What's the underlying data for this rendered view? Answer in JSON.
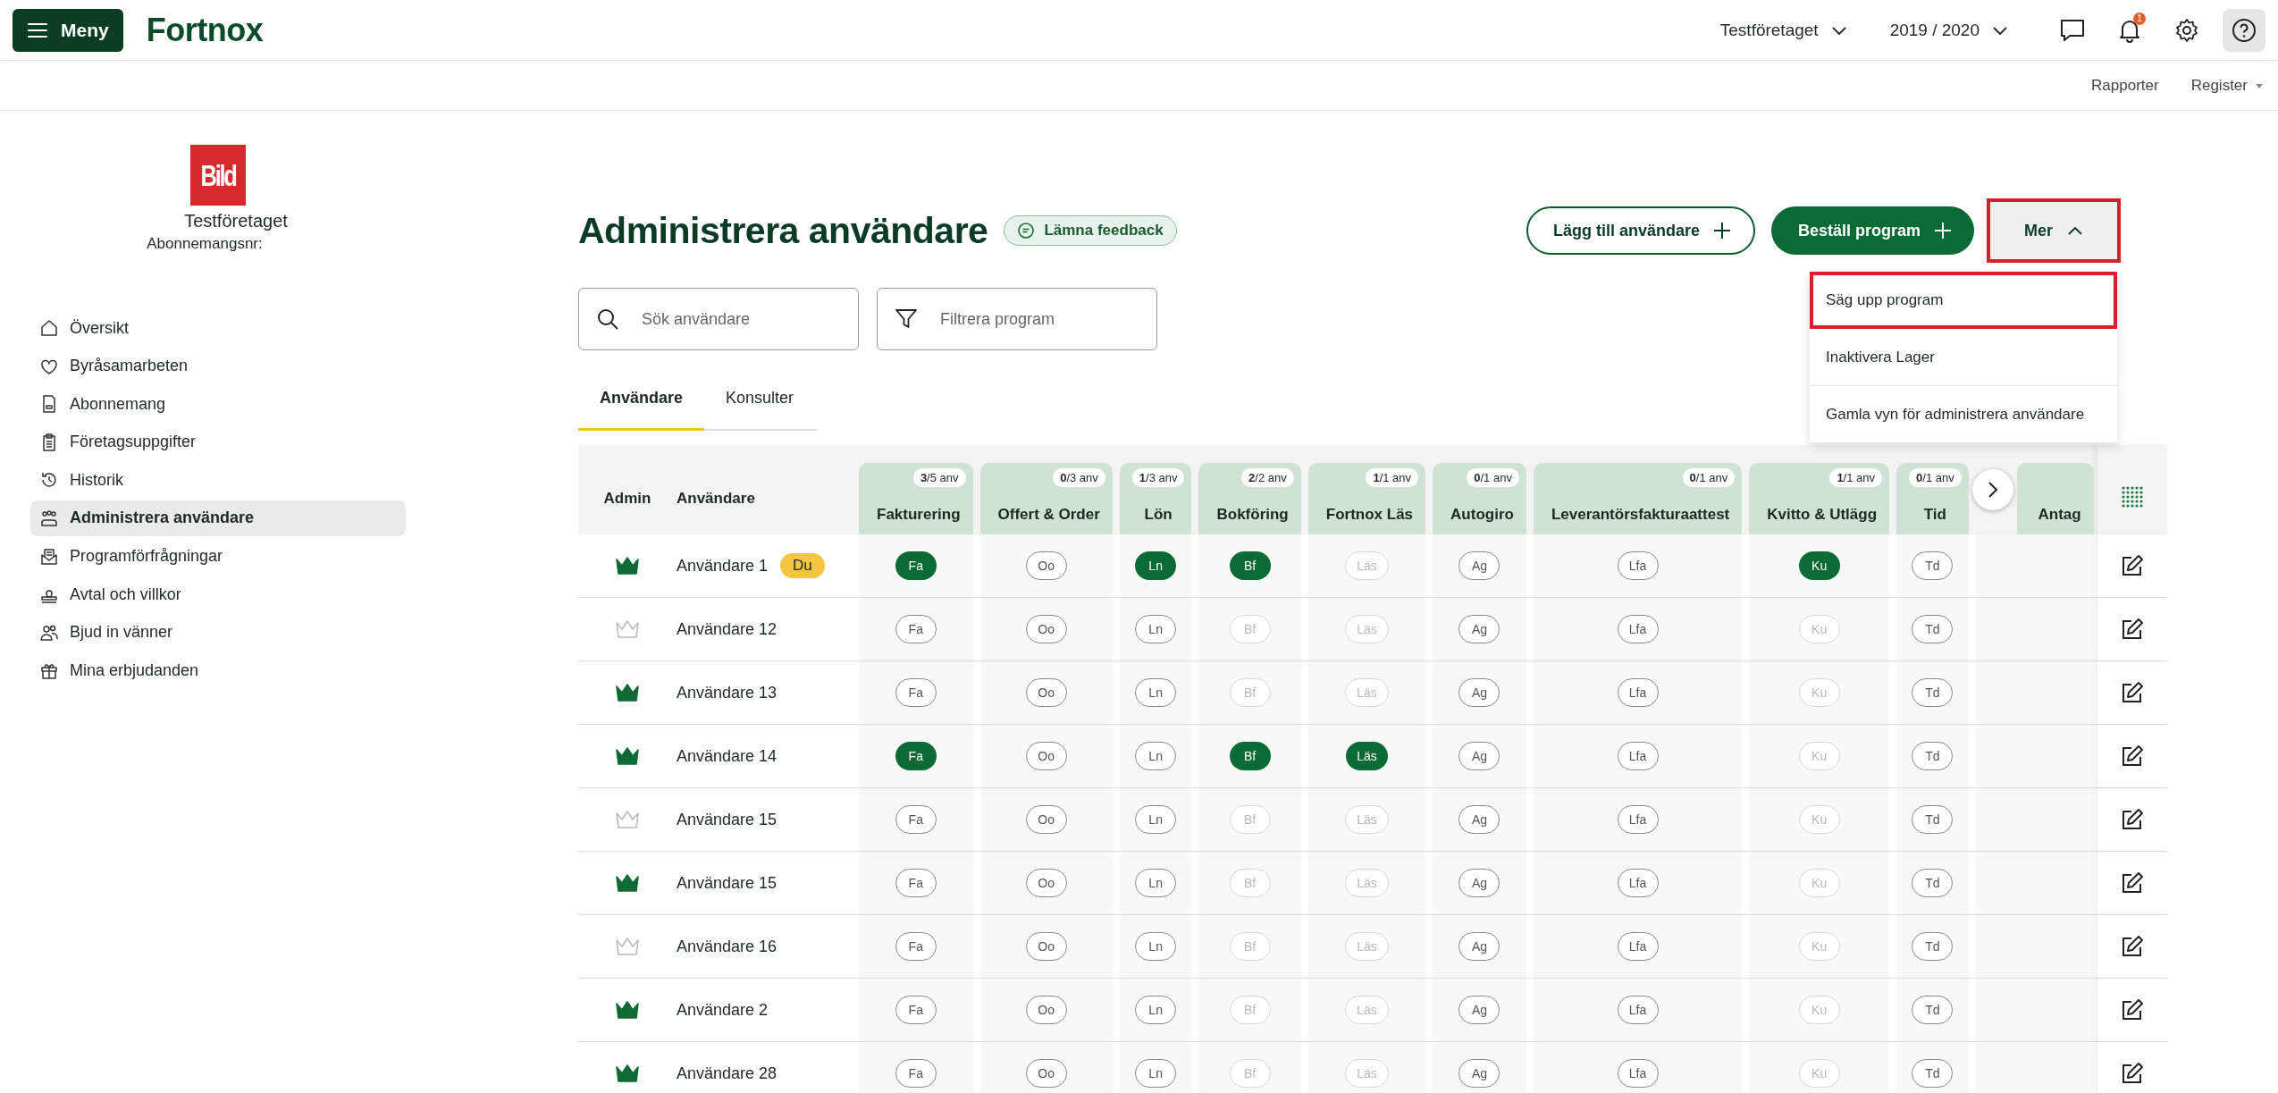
{
  "topbar": {
    "menu_button": "Meny",
    "logo": "Fortnox",
    "company": "Testföretaget",
    "year": "2019 / 2020",
    "notification_count": "1"
  },
  "subnav": [
    {
      "label": "Rapporter",
      "dropdown": false
    },
    {
      "label": "Register",
      "dropdown": true
    }
  ],
  "sidebar": {
    "logo_text": "Bild",
    "company": "Testföretaget",
    "subscription_label": "Abonnemangsnr:",
    "items": [
      {
        "label": "Översikt",
        "selected": false
      },
      {
        "label": "Byråsamarbeten",
        "selected": false
      },
      {
        "label": "Abonnemang",
        "selected": false
      },
      {
        "label": "Företagsuppgifter",
        "selected": false
      },
      {
        "label": "Historik",
        "selected": false
      },
      {
        "label": "Administrera användare",
        "selected": true
      },
      {
        "label": "Programförfrågningar",
        "selected": false
      },
      {
        "label": "Avtal och villkor",
        "selected": false
      },
      {
        "label": "Bjud in vänner",
        "selected": false
      },
      {
        "label": "Mina erbjudanden",
        "selected": false
      }
    ]
  },
  "page": {
    "title": "Administrera användare",
    "feedback_button": "Lämna feedback",
    "add_user_button": "Lägg till användare",
    "order_button": "Beställ program",
    "more_button": {
      "label": "Mer",
      "expanded": true,
      "highlighted": true
    },
    "more_menu": [
      {
        "label": "Säg upp program",
        "highlighted": true
      },
      {
        "label": "Inaktivera Lager",
        "highlighted": false
      },
      {
        "label": "Gamla vyn för administrera användare",
        "highlighted": false
      }
    ],
    "search": {
      "placeholder": "Sök användare"
    },
    "filter": {
      "placeholder": "Filtrera program"
    },
    "tabs": [
      {
        "label": "Användare",
        "selected": true
      },
      {
        "label": "Konsulter",
        "selected": false
      }
    ]
  },
  "table": {
    "admin_column": "Admin",
    "user_column": "Användare",
    "columns": [
      {
        "name": "Fakturering",
        "count": "**3**/5 anv"
      },
      {
        "name": "Offert & Order",
        "count": "**0**/3 anv"
      },
      {
        "name": "Lön",
        "count": "**1**/3 anv"
      },
      {
        "name": "Bokföring",
        "count": "**2**/2 anv"
      },
      {
        "name": "Fortnox Läs",
        "count": "**1**/1 anv"
      },
      {
        "name": "Autogiro",
        "count": "**0**/1 anv"
      },
      {
        "name": "Leverantörsfakturaattest",
        "count": "**0**/1 anv"
      },
      {
        "name": "Kvitto & Utlägg",
        "count": "**1**/1 anv"
      },
      {
        "name": "Tid",
        "count": "**0**/1 anv"
      },
      {
        "name": "Antag"
      }
    ],
    "rows": [
      {
        "name": "Användare 1",
        "admin": true,
        "badge": "Du",
        "cells": [
          {
            "label": "Fa",
            "on": true,
            "disabled": false
          },
          {
            "label": "Oo",
            "on": false,
            "disabled": false
          },
          {
            "label": "Ln",
            "on": true,
            "disabled": false
          },
          {
            "label": "Bf",
            "on": true,
            "disabled": false
          },
          {
            "label": "Läs",
            "on": false,
            "disabled": true
          },
          {
            "label": "Ag",
            "on": false,
            "disabled": false
          },
          {
            "label": "Lfa",
            "on": false,
            "disabled": false
          },
          {
            "label": "Ku",
            "on": true,
            "disabled": false
          },
          {
            "label": "Td",
            "on": false,
            "disabled": false
          }
        ]
      },
      {
        "name": "Användare 12",
        "admin": false,
        "cells": [
          {
            "label": "Fa",
            "on": false,
            "disabled": false
          },
          {
            "label": "Oo",
            "on": false,
            "disabled": false
          },
          {
            "label": "Ln",
            "on": false,
            "disabled": false
          },
          {
            "label": "Bf",
            "on": false,
            "disabled": true
          },
          {
            "label": "Läs",
            "on": false,
            "disabled": true
          },
          {
            "label": "Ag",
            "on": false,
            "disabled": false
          },
          {
            "label": "Lfa",
            "on": false,
            "disabled": false
          },
          {
            "label": "Ku",
            "on": false,
            "disabled": true
          },
          {
            "label": "Td",
            "on": false,
            "disabled": false
          }
        ]
      },
      {
        "name": "Användare 13",
        "admin": true,
        "cells": [
          {
            "label": "Fa",
            "on": false,
            "disabled": false
          },
          {
            "label": "Oo",
            "on": false,
            "disabled": false
          },
          {
            "label": "Ln",
            "on": false,
            "disabled": false
          },
          {
            "label": "Bf",
            "on": false,
            "disabled": true
          },
          {
            "label": "Läs",
            "on": false,
            "disabled": true
          },
          {
            "label": "Ag",
            "on": false,
            "disabled": false
          },
          {
            "label": "Lfa",
            "on": false,
            "disabled": false
          },
          {
            "label": "Ku",
            "on": false,
            "disabled": true
          },
          {
            "label": "Td",
            "on": false,
            "disabled": false
          }
        ]
      },
      {
        "name": "Användare 14",
        "admin": true,
        "cells": [
          {
            "label": "Fa",
            "on": true,
            "disabled": false
          },
          {
            "label": "Oo",
            "on": false,
            "disabled": false
          },
          {
            "label": "Ln",
            "on": false,
            "disabled": false
          },
          {
            "label": "Bf",
            "on": true,
            "disabled": false
          },
          {
            "label": "Läs",
            "on": true,
            "disabled": false
          },
          {
            "label": "Ag",
            "on": false,
            "disabled": false
          },
          {
            "label": "Lfa",
            "on": false,
            "disabled": false
          },
          {
            "label": "Ku",
            "on": false,
            "disabled": true
          },
          {
            "label": "Td",
            "on": false,
            "disabled": false
          }
        ]
      },
      {
        "name": "Användare 15",
        "admin": false,
        "cells": [
          {
            "label": "Fa",
            "on": false,
            "disabled": false
          },
          {
            "label": "Oo",
            "on": false,
            "disabled": false
          },
          {
            "label": "Ln",
            "on": false,
            "disabled": false
          },
          {
            "label": "Bf",
            "on": false,
            "disabled": true
          },
          {
            "label": "Läs",
            "on": false,
            "disabled": true
          },
          {
            "label": "Ag",
            "on": false,
            "disabled": false
          },
          {
            "label": "Lfa",
            "on": false,
            "disabled": false
          },
          {
            "label": "Ku",
            "on": false,
            "disabled": true
          },
          {
            "label": "Td",
            "on": false,
            "disabled": false
          }
        ]
      },
      {
        "name": "Användare 15",
        "admin": true,
        "cells": [
          {
            "label": "Fa",
            "on": false,
            "disabled": false
          },
          {
            "label": "Oo",
            "on": false,
            "disabled": false
          },
          {
            "label": "Ln",
            "on": false,
            "disabled": false
          },
          {
            "label": "Bf",
            "on": false,
            "disabled": true
          },
          {
            "label": "Läs",
            "on": false,
            "disabled": true
          },
          {
            "label": "Ag",
            "on": false,
            "disabled": false
          },
          {
            "label": "Lfa",
            "on": false,
            "disabled": false
          },
          {
            "label": "Ku",
            "on": false,
            "disabled": true
          },
          {
            "label": "Td",
            "on": false,
            "disabled": false
          }
        ]
      },
      {
        "name": "Användare 16",
        "admin": false,
        "cells": [
          {
            "label": "Fa",
            "on": false,
            "disabled": false
          },
          {
            "label": "Oo",
            "on": false,
            "disabled": false
          },
          {
            "label": "Ln",
            "on": false,
            "disabled": false
          },
          {
            "label": "Bf",
            "on": false,
            "disabled": true
          },
          {
            "label": "Läs",
            "on": false,
            "disabled": true
          },
          {
            "label": "Ag",
            "on": false,
            "disabled": false
          },
          {
            "label": "Lfa",
            "on": false,
            "disabled": false
          },
          {
            "label": "Ku",
            "on": false,
            "disabled": true
          },
          {
            "label": "Td",
            "on": false,
            "disabled": false
          }
        ]
      },
      {
        "name": "Användare 2",
        "admin": true,
        "cells": [
          {
            "label": "Fa",
            "on": false,
            "disabled": false
          },
          {
            "label": "Oo",
            "on": false,
            "disabled": false
          },
          {
            "label": "Ln",
            "on": false,
            "disabled": false
          },
          {
            "label": "Bf",
            "on": false,
            "disabled": true
          },
          {
            "label": "Läs",
            "on": false,
            "disabled": true
          },
          {
            "label": "Ag",
            "on": false,
            "disabled": false
          },
          {
            "label": "Lfa",
            "on": false,
            "disabled": false
          },
          {
            "label": "Ku",
            "on": false,
            "disabled": true
          },
          {
            "label": "Td",
            "on": false,
            "disabled": false
          }
        ]
      },
      {
        "name": "Användare 28",
        "admin": true,
        "cells": [
          {
            "label": "Fa",
            "on": false,
            "disabled": false
          },
          {
            "label": "Oo",
            "on": false,
            "disabled": false
          },
          {
            "label": "Ln",
            "on": false,
            "disabled": false
          },
          {
            "label": "Bf",
            "on": false,
            "disabled": true
          },
          {
            "label": "Läs",
            "on": false,
            "disabled": true
          },
          {
            "label": "Ag",
            "on": false,
            "disabled": false
          },
          {
            "label": "Lfa",
            "on": false,
            "disabled": false
          },
          {
            "label": "Ku",
            "on": false,
            "disabled": true
          },
          {
            "label": "Td",
            "on": false,
            "disabled": false
          }
        ]
      }
    ]
  }
}
